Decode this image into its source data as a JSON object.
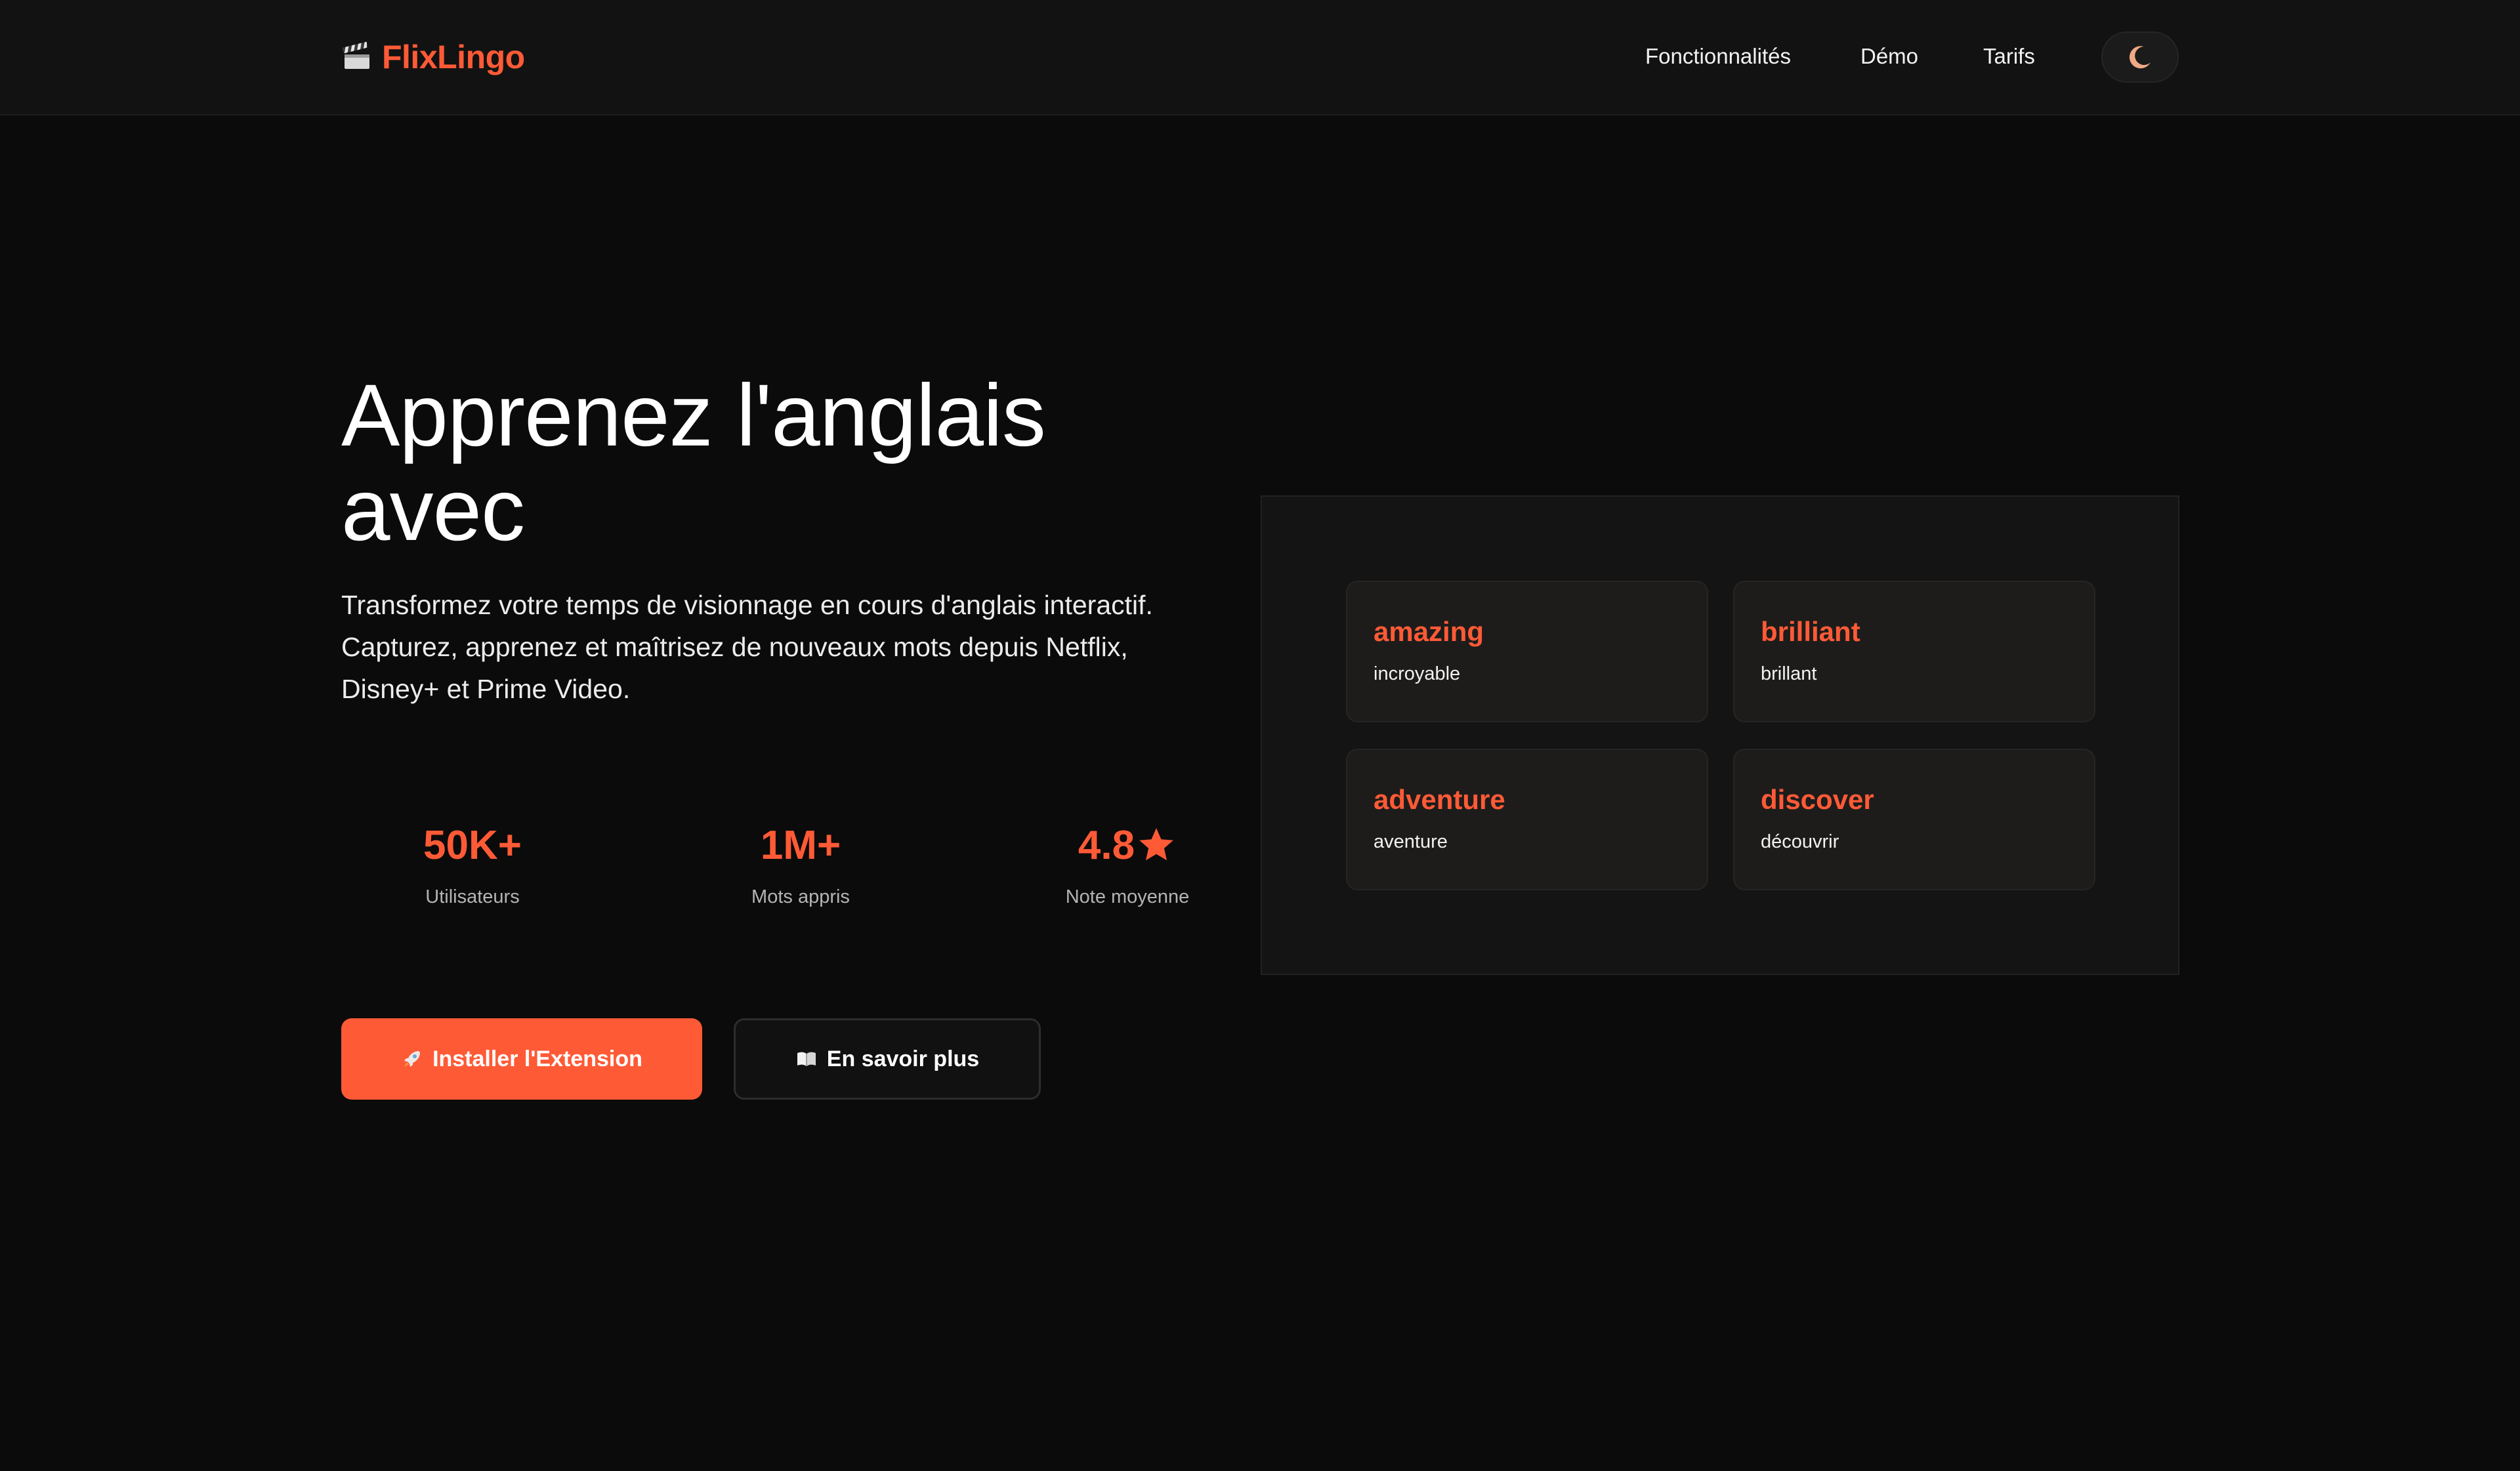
{
  "header": {
    "brand": "FlixLingo",
    "logo_icon": "clapperboard-icon",
    "nav": [
      "Fonctionnalités",
      "Démo",
      "Tarifs"
    ],
    "theme_toggle_icon": "moon-icon"
  },
  "hero": {
    "title": "Apprenez l'anglais avec",
    "subtitle": "Transformez votre temps de visionnage en cours d'anglais interactif. Capturez, apprenez et maîtrisez de nouveaux mots depuis Netflix, Disney+ et Prime Video.",
    "stats": [
      {
        "value": "50K+",
        "label": "Utilisateurs"
      },
      {
        "value": "1M+",
        "label": "Mots appris"
      },
      {
        "value": "4.8",
        "suffix_icon": "star-icon",
        "label": "Note moyenne"
      }
    ],
    "primary_button": {
      "icon": "rocket-icon",
      "label": "Installer l'Extension"
    },
    "secondary_button": {
      "icon": "open-book-icon",
      "label": "En savoir plus"
    }
  },
  "vocab_cards": [
    {
      "word": "amazing",
      "translation": "incroyable"
    },
    {
      "word": "brilliant",
      "translation": "brillant"
    },
    {
      "word": "adventure",
      "translation": "aventure"
    },
    {
      "word": "discover",
      "translation": "découvrir"
    }
  ],
  "colors": {
    "accent": "#ff5a36",
    "background": "#0b0b0b",
    "header": "#121212",
    "card": "#1d1c1b"
  }
}
